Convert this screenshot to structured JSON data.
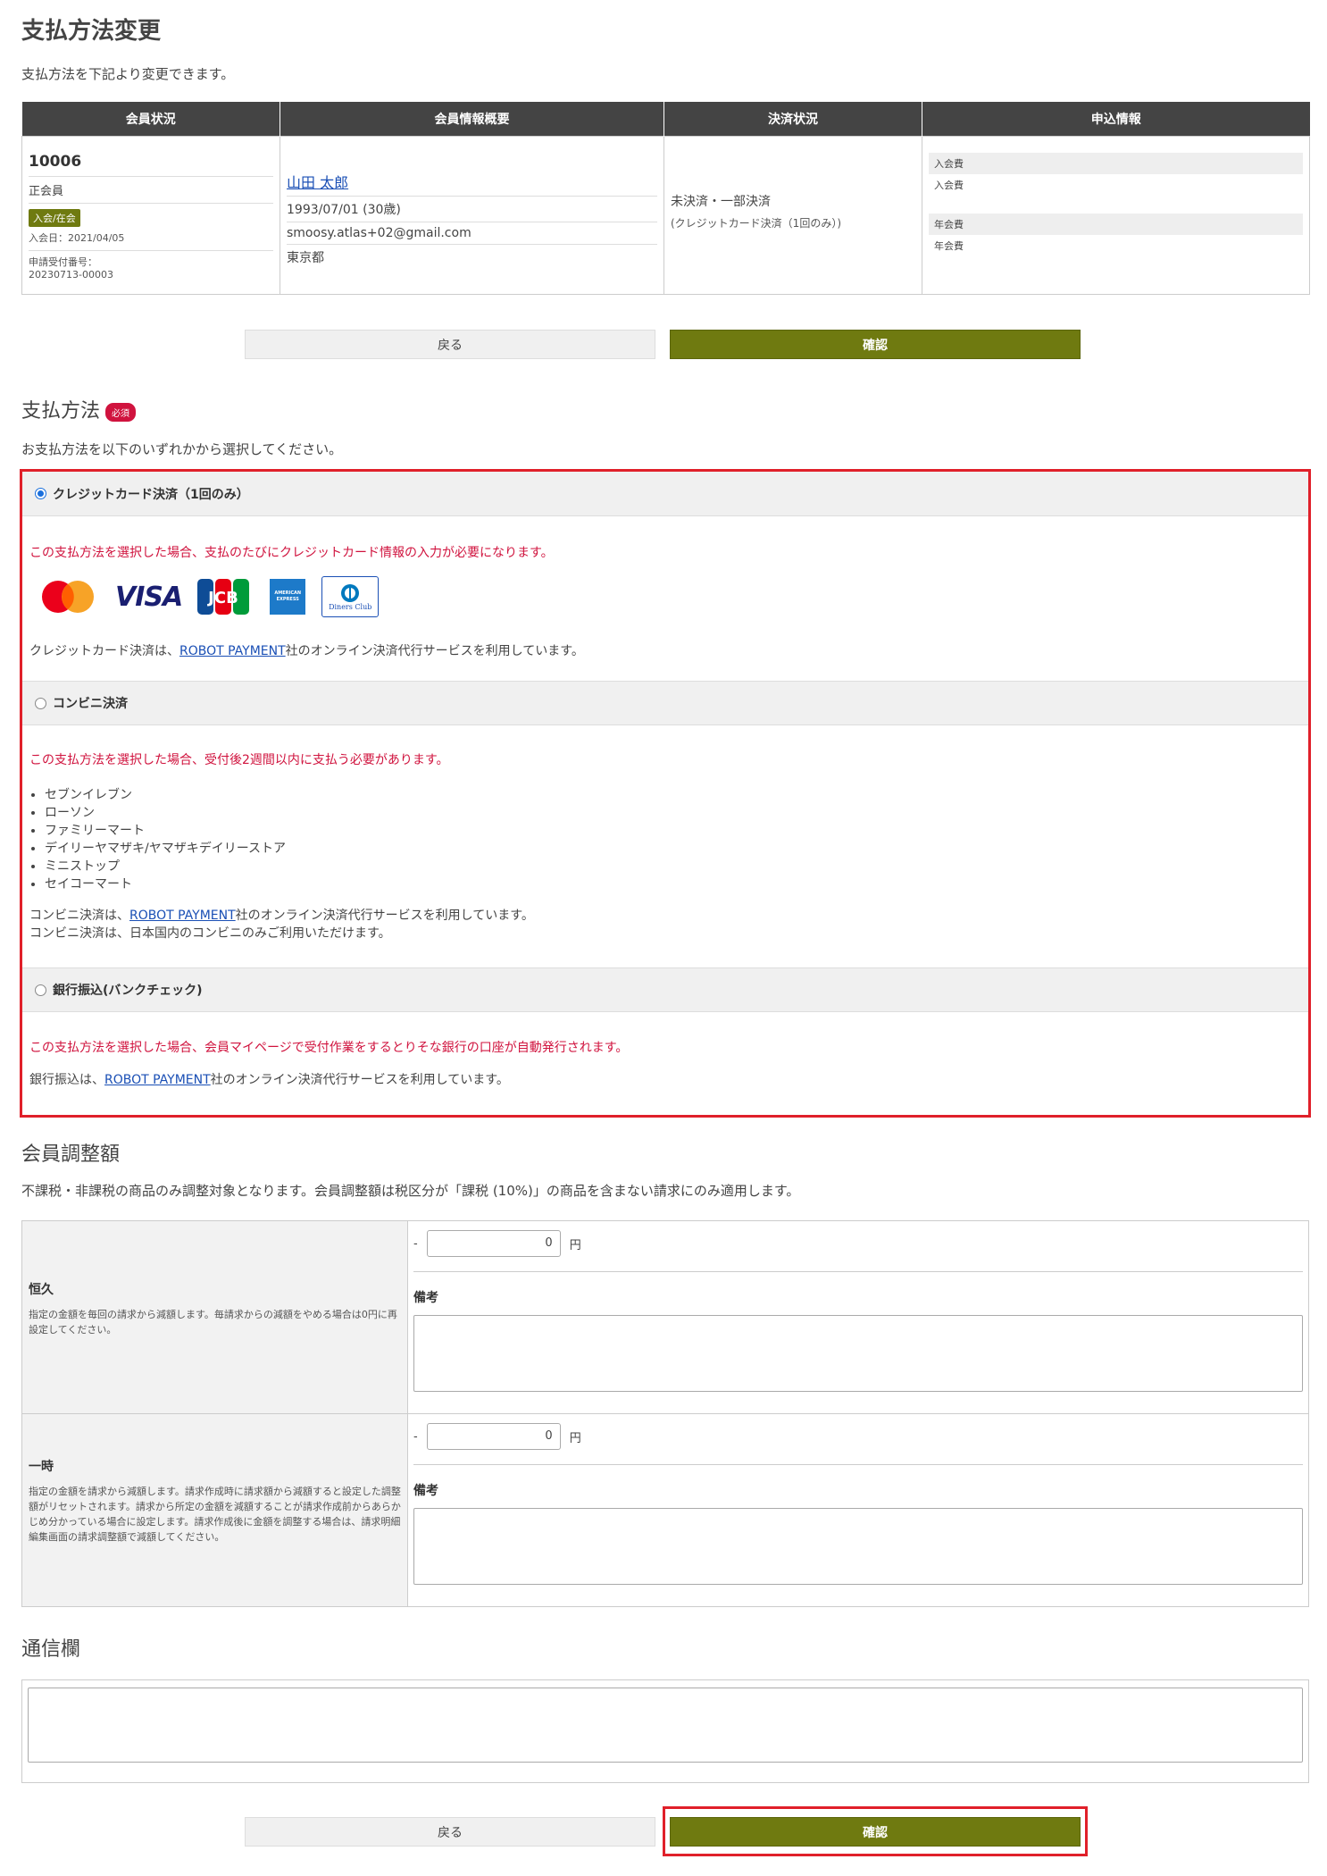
{
  "page": {
    "title": "支払方法変更",
    "description": "支払方法を下記より変更できます。"
  },
  "member_table": {
    "headers": [
      "会員状況",
      "会員情報概要",
      "決済状況",
      "申込情報"
    ],
    "member_id": "10006",
    "rank": "正会員",
    "status_badge": "入会/在会",
    "joined_date": "入会日：2021/04/05",
    "application_label": "申請受付番号：",
    "application_no": "20230713-00003",
    "name": "山田 太郎",
    "birth": "1993/07/01 (30歳)",
    "email": "smoosy.atlas+02@gmail.com",
    "pref": "東京都",
    "payment_status": "未決済・一部決済",
    "payment_method": "(クレジットカード決済（1回のみ）)",
    "app_items": [
      {
        "label": "入会費",
        "value": "入会費"
      },
      {
        "label": "年会費",
        "value": "年会費"
      }
    ]
  },
  "buttons": {
    "back": "戻る",
    "confirm": "確認"
  },
  "payment": {
    "title": "支払方法",
    "required": "必須",
    "description": "お支払方法を以下のいずれかから選択してください。",
    "credit": {
      "label": "クレジットカード決済（1回のみ）",
      "warning": "この支払方法を選択した場合、支払のたびにクレジットカード情報の入力が必要になります。",
      "note_pre": "クレジットカード決済は、",
      "provider": "ROBOT PAYMENT",
      "note_post": "社のオンライン決済代行サービスを利用しています。",
      "cards": {
        "visa": "VISA",
        "jcb": "JCB",
        "amex": "AMERICAN EXPRESS",
        "diners": "Diners Club"
      }
    },
    "convenience": {
      "label": "コンビニ決済",
      "warning": "この支払方法を選択した場合、受付後2週間以内に支払う必要があります。",
      "stores": [
        "セブンイレブン",
        "ローソン",
        "ファミリーマート",
        "デイリーヤマザキ/ヤマザキデイリーストア",
        "ミニストップ",
        "セイコーマート"
      ],
      "note_pre": "コンビニ決済は、",
      "provider": "ROBOT PAYMENT",
      "note_post": "社のオンライン決済代行サービスを利用しています。",
      "note2": "コンビニ決済は、日本国内のコンビニのみご利用いただけます。"
    },
    "bank": {
      "label": "銀行振込(バンクチェック)",
      "warning": "この支払方法を選択した場合、会員マイページで受付作業をするとりそな銀行の口座が自動発行されます。",
      "note_pre": "銀行振込は、",
      "provider": "ROBOT PAYMENT",
      "note_post": "社のオンライン決済代行サービスを利用しています。"
    }
  },
  "adjustment": {
    "title": "会員調整額",
    "description": "不課税・非課税の商品のみ調整対象となります。会員調整額は税区分が「課税 (10%)」の商品を含まない請求にのみ適用します。",
    "permanent": {
      "label": "恒久",
      "desc": "指定の金額を毎回の請求から減額します。毎請求からの減額をやめる場合は0円に再設定してください。",
      "minus": "-",
      "value": "0",
      "unit": "円",
      "note_label": "備考"
    },
    "temporary": {
      "label": "一時",
      "desc": "指定の金額を請求から減額します。請求作成時に請求額から減額すると設定した調整額がリセットされます。請求から所定の金額を減額することが請求作成前からあらかじめ分かっている場合に設定します。請求作成後に金額を調整する場合は、請求明細編集画面の請求調整額で減額してください。",
      "minus": "-",
      "value": "0",
      "unit": "円",
      "note_label": "備考"
    }
  },
  "communication": {
    "title": "通信欄"
  }
}
